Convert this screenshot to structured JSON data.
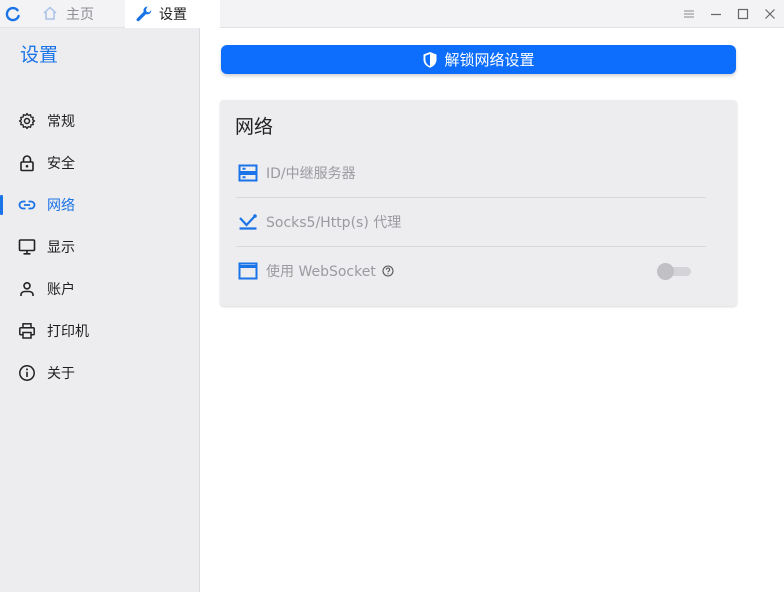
{
  "titlebar": {
    "tabs": [
      {
        "label": "主页",
        "icon": "home-icon"
      },
      {
        "label": "设置",
        "icon": "wrench-icon"
      }
    ],
    "controls": [
      "menu-icon",
      "minimize-icon",
      "maximize-icon",
      "close-icon"
    ]
  },
  "sidebar": {
    "title": "设置",
    "items": [
      {
        "label": "常规",
        "icon": "gear-icon"
      },
      {
        "label": "安全",
        "icon": "lock-icon"
      },
      {
        "label": "网络",
        "icon": "link-icon",
        "active": true
      },
      {
        "label": "显示",
        "icon": "monitor-icon"
      },
      {
        "label": "账户",
        "icon": "user-icon"
      },
      {
        "label": "打印机",
        "icon": "printer-icon"
      },
      {
        "label": "关于",
        "icon": "info-icon"
      }
    ]
  },
  "main": {
    "unlock_button": "解锁网络设置",
    "network_card": {
      "title": "网络",
      "rows": [
        {
          "label": "ID/中继服务器",
          "icon": "server-icon"
        },
        {
          "label": "Socks5/Http(s) 代理",
          "icon": "proxy-icon"
        },
        {
          "label": "使用 WebSocket",
          "icon": "window-icon",
          "toggle": false
        }
      ]
    }
  },
  "colors": {
    "accent": "#1b73e8",
    "button": "#0d6efd",
    "sidebar_bg": "#ededf0",
    "muted_text": "#9a9aa0"
  }
}
